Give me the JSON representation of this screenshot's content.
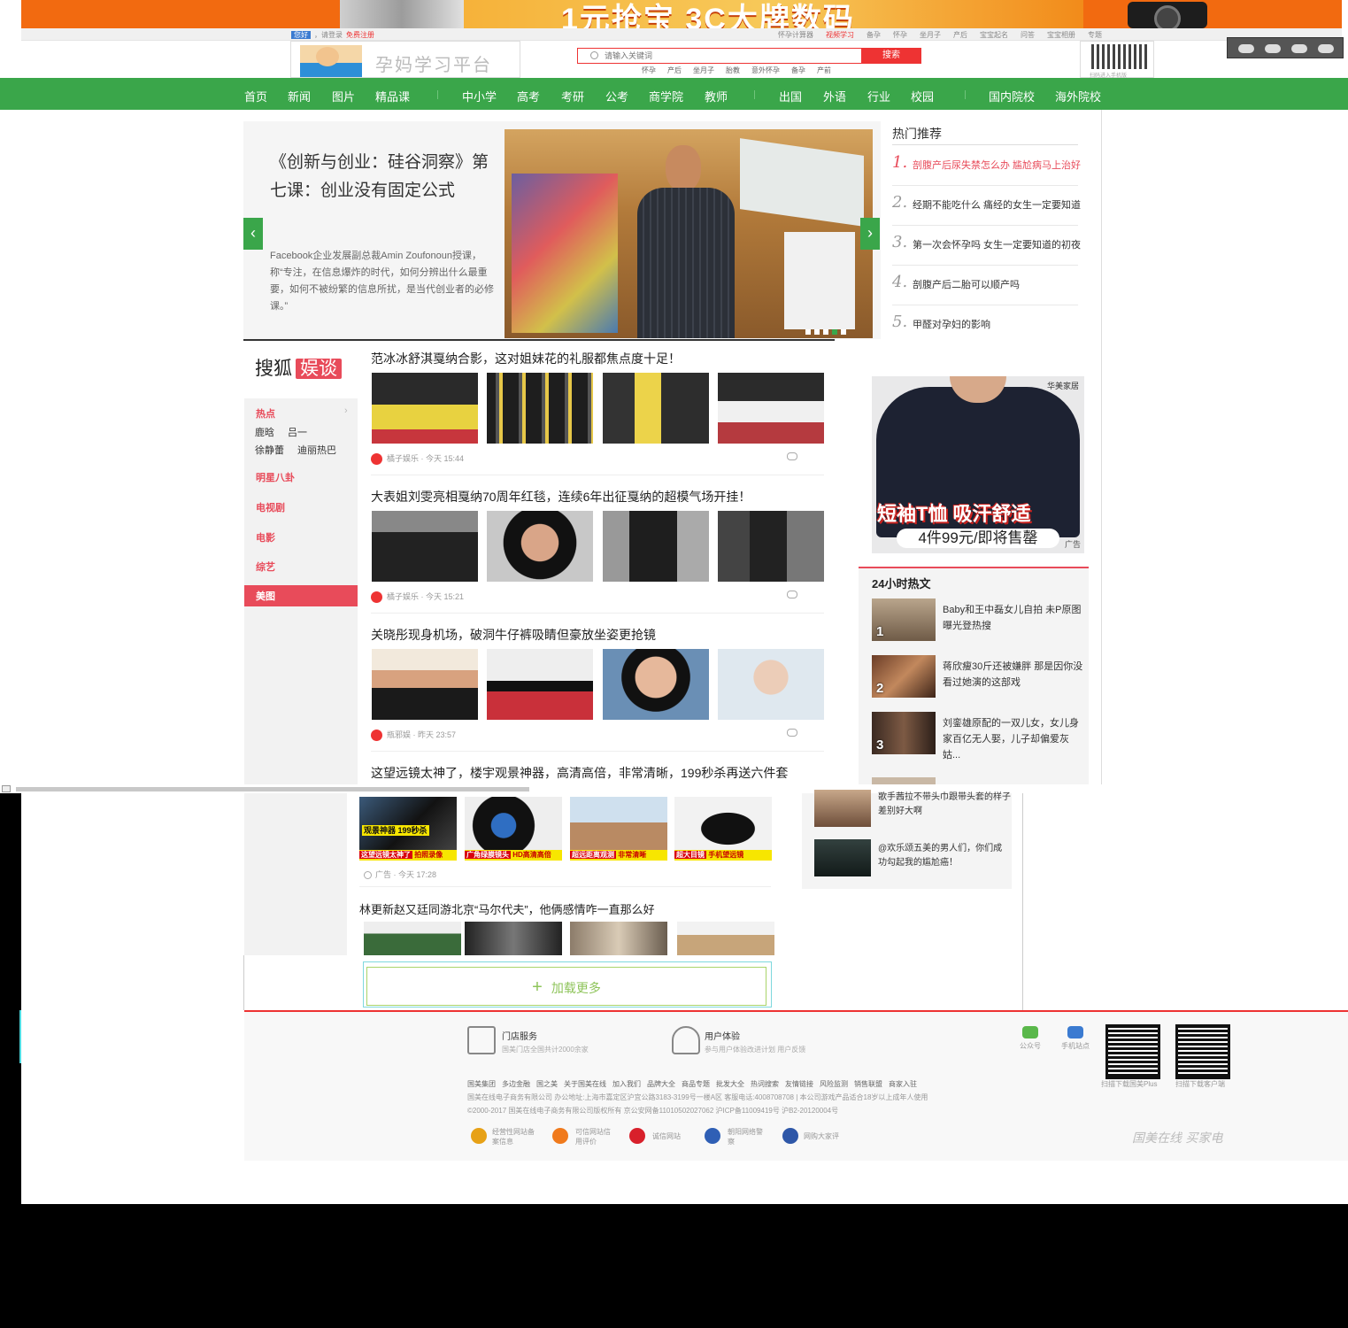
{
  "banner": {
    "promo": "1元抢宝 3C大牌数码"
  },
  "toplinks": {
    "greeting_badge": "您好",
    "login": "，请登录",
    "register": "免费注册",
    "items": [
      "怀孕计算器",
      "视频学习",
      "备孕",
      "怀孕",
      "坐月子",
      "产后",
      "宝宝起名",
      "问答",
      "宝宝相册",
      "专题"
    ]
  },
  "logo": {
    "title": "孕妈学习平台"
  },
  "search": {
    "placeholder": "请输入关键词",
    "button": "搜索",
    "hotwords": [
      "怀孕",
      "产后",
      "坐月子",
      "胎教",
      "意外怀孕",
      "备孕",
      "产前"
    ]
  },
  "qr_top": {
    "caption": "扫码进入手机版"
  },
  "nav": {
    "items": [
      "首页",
      "新闻",
      "图片",
      "精品课",
      "中小学",
      "高考",
      "考研",
      "公考",
      "商学院",
      "教师",
      "出国",
      "外语",
      "行业",
      "校园",
      "国内院校",
      "海外院校"
    ]
  },
  "hero": {
    "title": "《创新与创业：硅谷洞察》第七课：创业没有固定公式",
    "desc": "Facebook企业发展副总裁Amin Zoufonoun授课，称“专注，在信息爆炸的时代，如何分辨出什么最重要，如何不被纷繁的信息所扰，是当代创业者的必修课。”"
  },
  "hot": {
    "title": "热门推荐",
    "items": [
      {
        "num": "1.",
        "text": "剖腹产后尿失禁怎么办 尴尬病马上治好"
      },
      {
        "num": "2.",
        "text": "经期不能吃什么 痛经的女生一定要知道"
      },
      {
        "num": "3.",
        "text": "第一次会怀孕吗 女生一定要知道的初夜"
      },
      {
        "num": "4.",
        "text": "剖腹产后二胎可以顺产吗"
      },
      {
        "num": "5.",
        "text": "甲醛对孕妇的影响"
      }
    ]
  },
  "ent": {
    "logo": "搜狐",
    "logo_badge": "娱谈",
    "hot_label": "热点",
    "hot_tags": [
      "鹿晗",
      "吕一",
      "徐静蕾",
      "迪丽热巴"
    ],
    "cats": [
      "明星八卦",
      "电视剧",
      "电影",
      "综艺"
    ],
    "active": "美图"
  },
  "articles": [
    {
      "title": "范冰冰舒淇戛纳合影，这对姐妹花的礼服都焦点度十足！",
      "source": "橘子娱乐",
      "time": "今天 15:44"
    },
    {
      "title": "大表姐刘雯亮相戛纳70周年红毯，连续6年出征戛纳的超模气场开挂！",
      "source": "橘子娱乐",
      "time": "今天 15:21"
    },
    {
      "title": "关晓彤现身机场，破洞牛仔裤吸睛但豪放坐姿更抢镜",
      "source": "瓶邪娱",
      "time": "昨天 23:57"
    },
    {
      "title": "这望远镜太神了，楼宇观景神器，高清高倍，非常清晰，199秒杀再送六件套"
    }
  ],
  "ad_right": {
    "brand": "华美家居",
    "slogan": "短袖T恤 吸汗舒适",
    "price": "4件99元/即将售罄",
    "tag": "广告"
  },
  "hot24": {
    "title": "24小时热文",
    "items": [
      {
        "n": "1",
        "text": "Baby和王中磊女儿自拍 未P原图曝光登热搜"
      },
      {
        "n": "2",
        "text": "蒋欣瘦30斤还被嫌胖 那是因你没看过她演的这部戏"
      },
      {
        "n": "3",
        "text": "刘銮雄原配的一双儿女，女儿身家百亿无人娶，儿子却偏爱灰姑..."
      }
    ]
  },
  "ad_thumbs": [
    {
      "tag": "观景神器 199秒杀",
      "cap_a": "这望远镜太神了",
      "cap_b": "拍照录像"
    },
    {
      "cap_a": "广角绿膜镜头",
      "cap_b": "HD高清高倍"
    },
    {
      "cap_a": "超远距离观测",
      "cap_b": "非常清晰"
    },
    {
      "cap_a": "超大目镜",
      "cap_b": "手机望远镜"
    }
  ],
  "ad_meta": {
    "label": "广告",
    "time": "今天 17:28"
  },
  "lower_article": {
    "title": "林更新赵又廷同游北京“马尔代夫”，他俩感情咋一直那么好"
  },
  "load_more": "加载更多",
  "lower_right": [
    {
      "text": "歌手茜拉不带头巾跟带头套的样子差别好大啊"
    },
    {
      "text": "@欢乐颂五美的男人们，你们成功勾起我的尴尬癌！"
    }
  ],
  "footer": {
    "svc1": {
      "title": "门店服务",
      "sub": "国美门店全国共计2000余家"
    },
    "svc2": {
      "title": "用户体验",
      "sub": "参与用户体验改进计划 用户反馈"
    },
    "mini1": "公众号",
    "mini2": "手机站点",
    "qr1": "扫描下载国美Plus",
    "qr2": "扫描下载客户端",
    "links": [
      "国美集团",
      "多边金融",
      "国之美",
      "关于国美在线",
      "加入我们",
      "品牌大全",
      "商品专题",
      "批发大全",
      "热词搜索",
      "友情链接",
      "风险监测",
      "销售联盟",
      "商家入驻"
    ],
    "info1": "国美在线电子商务有限公司  办公地址:上海市嘉定区沪宜公路3183-3199号一楼A区  客服电话:4008708708  |  本公司游戏产品适合18岁以上成年人使用",
    "info2": "©2000-2017  国美在线电子商务有限公司版权所有  京公安网备11010502027062  沪ICP备11009419号  沪B2-20120004号",
    "badges": [
      "经营性网站备案信息",
      "可信网站信用评价",
      "诚信网站",
      "朝阳网络警察",
      "网购大家评"
    ],
    "slogan": "国美在线 买家电"
  }
}
